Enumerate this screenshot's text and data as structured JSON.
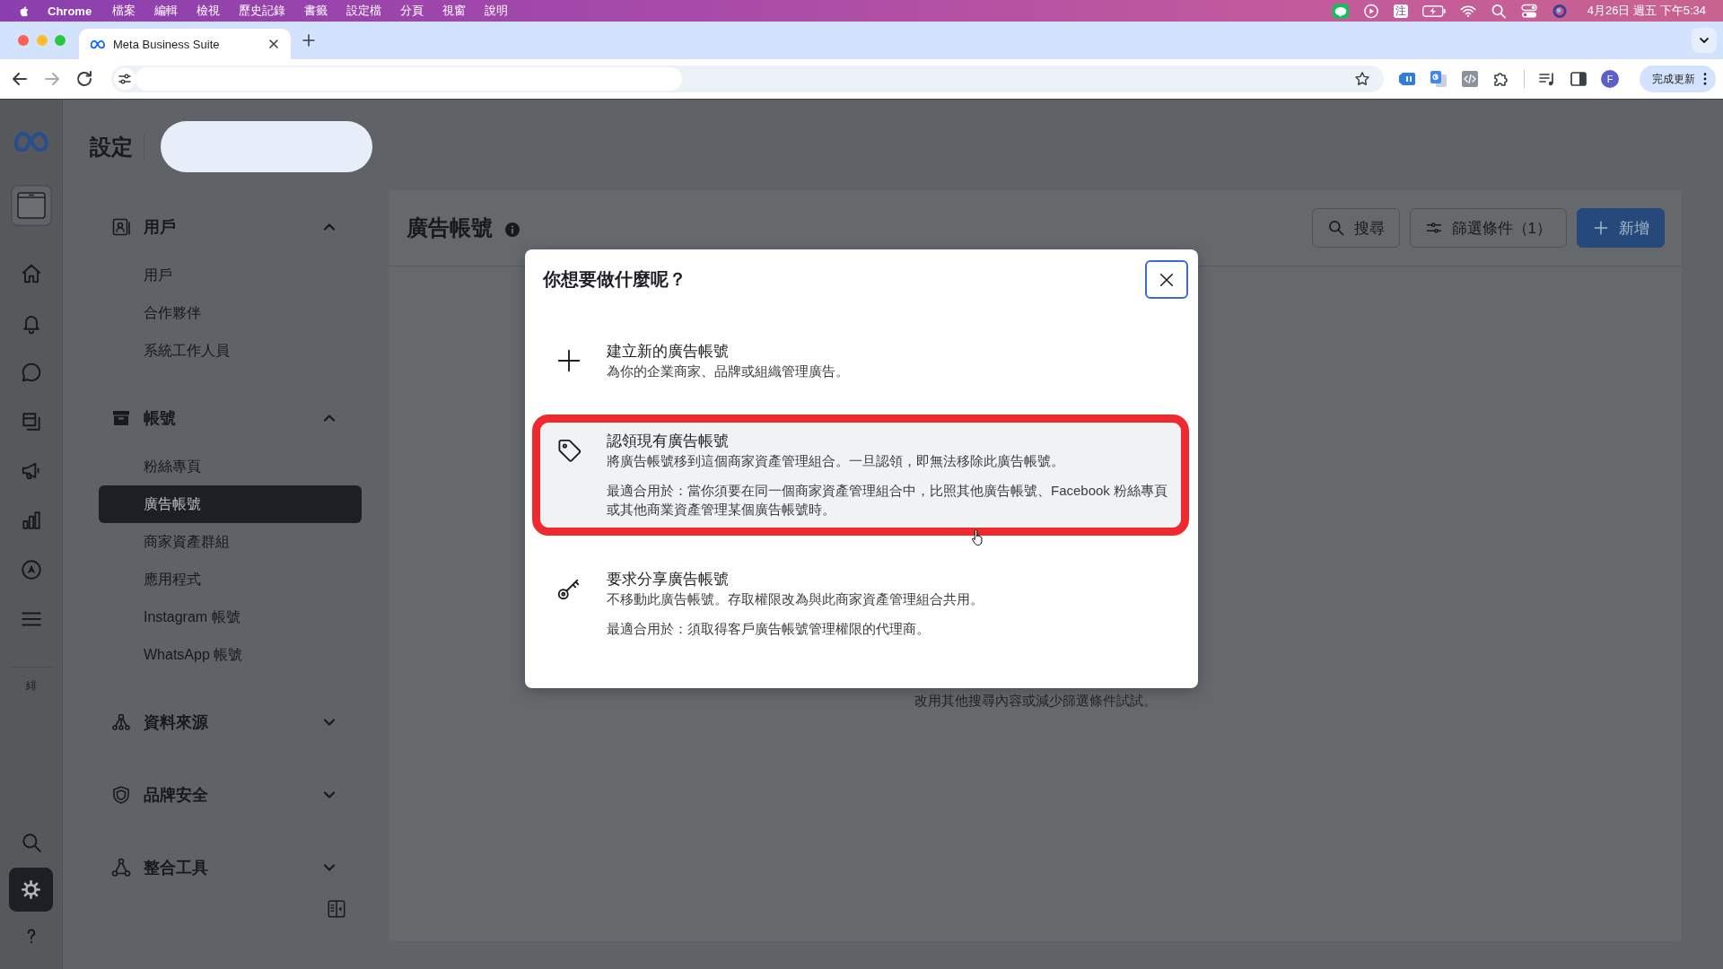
{
  "menu_bar": {
    "app_name": "Chrome",
    "menus": [
      "檔案",
      "編輯",
      "檢視",
      "歷史記錄",
      "書籤",
      "設定檔",
      "分頁",
      "視窗",
      "說明"
    ],
    "input_method": "注",
    "clock": "4月26日 週五 下午5:34"
  },
  "browser": {
    "tabs": [
      {
        "title": "Meta Business Suite",
        "selected": true
      }
    ],
    "profile_initial": "F",
    "update_button": "完成更新"
  },
  "rail": {
    "items": [
      {
        "kind": "account",
        "selected": false
      },
      {
        "kind": "home",
        "selected": false
      },
      {
        "kind": "bell",
        "selected": false
      },
      {
        "kind": "chat",
        "selected": false
      },
      {
        "kind": "pages",
        "selected": false
      },
      {
        "kind": "megaphone",
        "selected": false
      },
      {
        "kind": "chart",
        "selected": false
      },
      {
        "kind": "compass",
        "selected": false
      },
      {
        "kind": "menu",
        "selected": false
      }
    ],
    "shortcut_label": "緋",
    "bottom_items": [
      {
        "kind": "search",
        "selected": false
      },
      {
        "kind": "settings",
        "selected": true
      },
      {
        "kind": "help",
        "selected": false
      }
    ]
  },
  "settings_nav": {
    "title": "設定",
    "sections": [
      {
        "kind": "users",
        "label": "用戶",
        "expanded": true,
        "items": [
          {
            "label": "用戶",
            "selected": false
          },
          {
            "label": "合作夥伴",
            "selected": false
          },
          {
            "label": "系統工作人員",
            "selected": false
          }
        ]
      },
      {
        "kind": "accounts",
        "label": "帳號",
        "expanded": true,
        "items": [
          {
            "label": "粉絲專頁",
            "selected": false
          },
          {
            "label": "廣告帳號",
            "selected": true
          },
          {
            "label": "商家資產群組",
            "selected": false
          },
          {
            "label": "應用程式",
            "selected": false
          },
          {
            "label": "Instagram 帳號",
            "selected": false
          },
          {
            "label": "WhatsApp 帳號",
            "selected": false
          }
        ]
      },
      {
        "kind": "sources",
        "label": "資料來源",
        "expanded": false
      },
      {
        "kind": "safety",
        "label": "品牌安全",
        "expanded": false
      },
      {
        "kind": "integrations",
        "label": "整合工具",
        "expanded": false
      }
    ]
  },
  "content": {
    "title": "廣告帳號",
    "search_button": "搜尋",
    "filter_button": "篩選條件（1）",
    "add_button": "新增",
    "empty_hint": "改用其他搜尋內容或減少篩選條件試試。"
  },
  "dialog": {
    "title": "你想要做什麼呢？",
    "options": [
      {
        "kind": "plus",
        "title": "建立新的廣告帳號",
        "description": "為你的企業商家、品牌或組織管理廣告。",
        "highlighted": false
      },
      {
        "kind": "tag",
        "title": "認領現有廣告帳號",
        "description": "將廣告帳號移到這個商家資產管理組合。一旦認領，即無法移除此廣告帳號。",
        "best_for": "最適合用於：當你須要在同一個商家資產管理組合中，比照其他廣告帳號、Facebook 粉絲專頁或其他商業資產管理某個廣告帳號時。",
        "highlighted": true
      },
      {
        "kind": "key",
        "title": "要求分享廣告帳號",
        "description": "不移動此廣告帳號。存取權限改為與此商家資產管理組合共用。",
        "best_for": "最適合用於：須取得客戶廣告帳號管理權限的代理商。",
        "highlighted": false
      }
    ]
  }
}
